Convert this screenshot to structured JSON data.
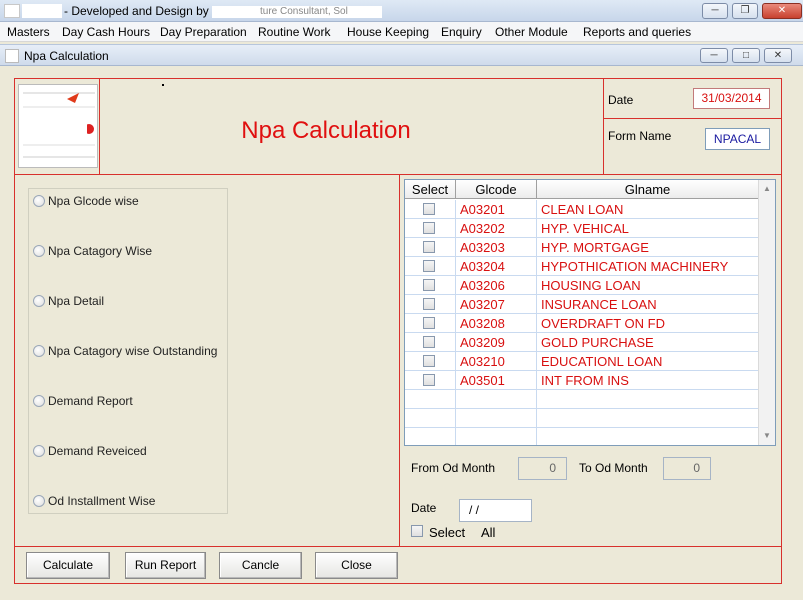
{
  "window": {
    "title": "- Developed and Design by",
    "title_suffix": "ture Consultant, Sol"
  },
  "menu": [
    "Masters",
    "Day Cash Hours",
    "Day Preparation",
    "Routine  Work",
    "House Keeping",
    "Enquiry",
    "Other Module",
    "Reports and queries"
  ],
  "child_window": {
    "title": "Npa Calculation"
  },
  "header": {
    "title": "Npa Calculation",
    "date_label": "Date",
    "date_value": "31/03/2014",
    "form_name_label": "Form Name",
    "form_name_value": "NPACAL"
  },
  "report_options": [
    "Npa Glcode wise",
    "Npa Catagory Wise",
    "Npa Detail",
    "Npa Catagory wise Outstanding",
    "Demand Report",
    "Demand Reveiced",
    "Od Installment Wise"
  ],
  "grid": {
    "columns": [
      "Select",
      "Glcode",
      "Glname"
    ],
    "rows": [
      {
        "glcode": "A03201",
        "glname": "CLEAN LOAN"
      },
      {
        "glcode": "A03202",
        "glname": "HYP. VEHICAL"
      },
      {
        "glcode": "A03203",
        "glname": "HYP. MORTGAGE"
      },
      {
        "glcode": "A03204",
        "glname": "HYPOTHICATION MACHINERY"
      },
      {
        "glcode": "A03206",
        "glname": "HOUSING LOAN"
      },
      {
        "glcode": "A03207",
        "glname": "INSURANCE LOAN"
      },
      {
        "glcode": "A03208",
        "glname": "OVERDRAFT ON FD"
      },
      {
        "glcode": "A03209",
        "glname": "GOLD PURCHASE"
      },
      {
        "glcode": "A03210",
        "glname": "EDUCATIONL LOAN"
      },
      {
        "glcode": "A03501",
        "glname": "INT FROM INS"
      }
    ]
  },
  "filters": {
    "from_od_month_label": "From Od Month",
    "from_od_month_value": "0",
    "to_od_month_label": "To Od Month",
    "to_od_month_value": "0",
    "date_label": "Date",
    "date_value": "/ /",
    "select_label": "Select",
    "all_label": "All"
  },
  "buttons": {
    "calculate": "Calculate",
    "run_report": "Run Report",
    "cancle": "Cancle",
    "close": "Close"
  },
  "colors": {
    "accent_red": "#d8302c",
    "data_red": "#d81010"
  }
}
